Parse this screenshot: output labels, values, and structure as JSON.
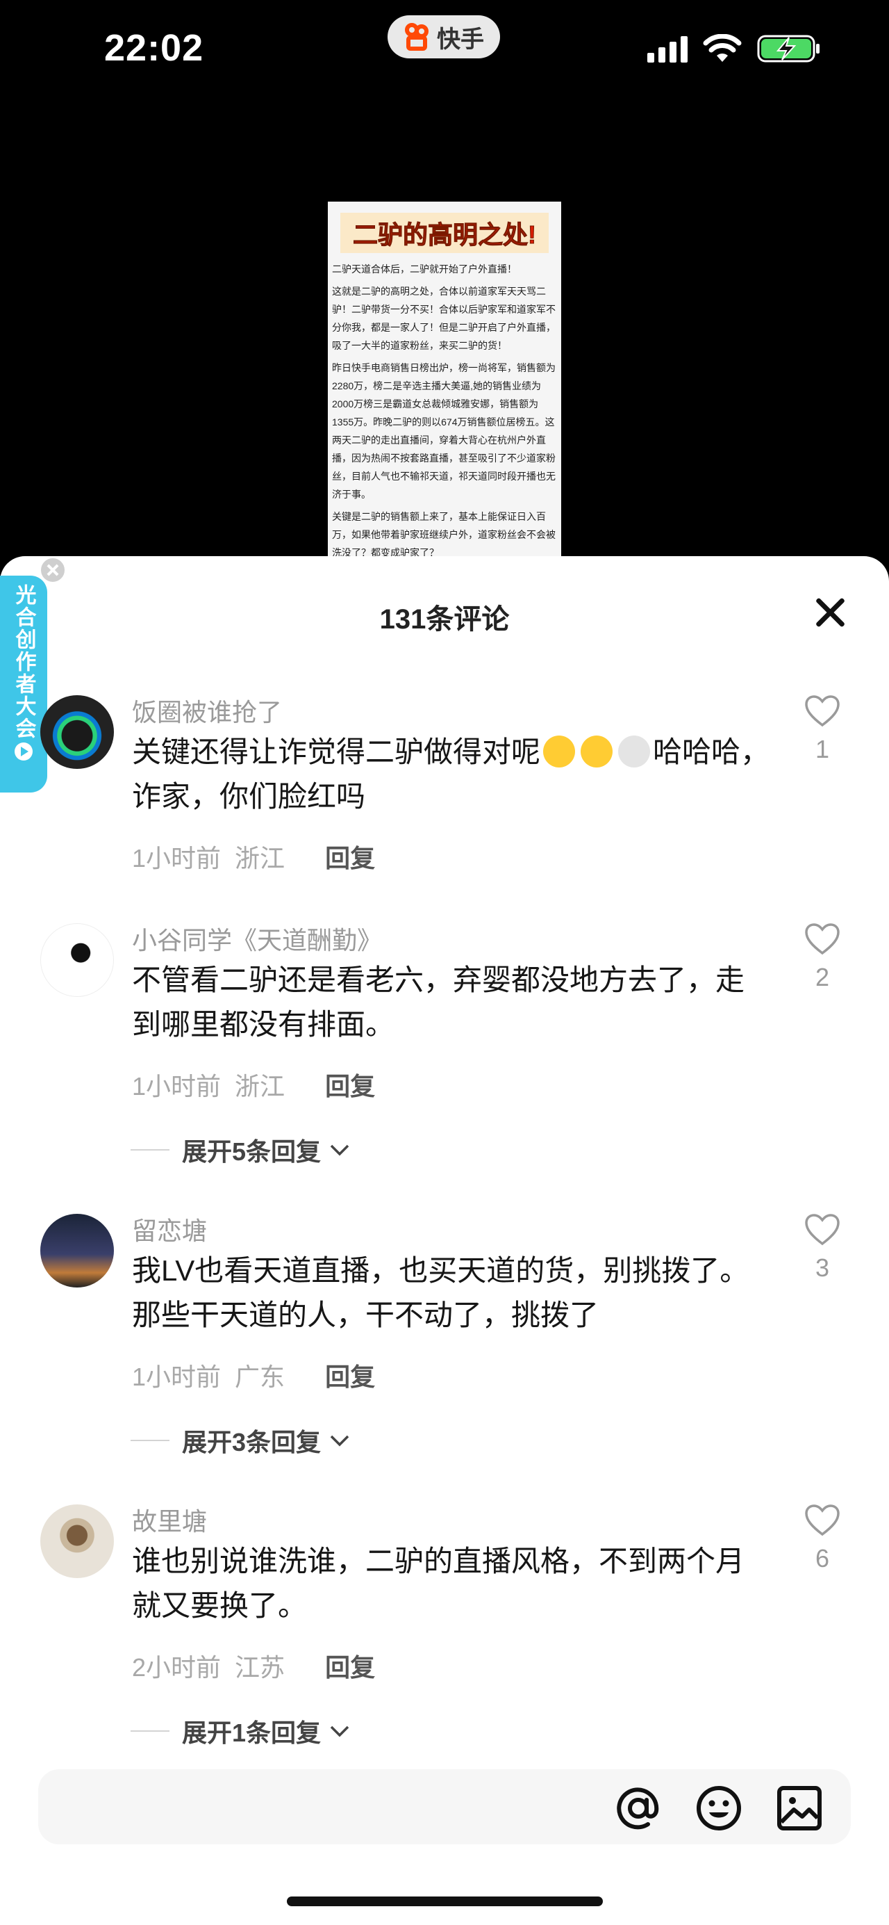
{
  "status_bar": {
    "time": "22:02",
    "app_name": "快手",
    "icons": [
      "signal-icon",
      "wifi-icon",
      "battery-charging-icon"
    ],
    "battery_color": "#4cd964"
  },
  "video": {
    "doc_title": "二驴的高明之处!",
    "paragraphs": [
      "二驴天道合体后，二驴就开始了户外直播！",
      "这就是二驴的高明之处，合体以前道家军天天骂二驴！二驴带货一分不买！合体以后驴家军和道家军不分你我，都是一家人了！但是二驴开启了户外直播，吸了一大半的道家粉丝，来买二驴的货！",
      "昨日快手电商销售日榜出炉，榜一尚将军，销售额为2280万，榜二是辛选主播大美逼,她的销售业绩为2000万榜三是霸道女总裁倾城雅安娜，销售额为1355万。昨晚二驴的则以674万销售额位居榜五。这两天二驴的走出直播间，穿着大背心在杭州户外直播，因为热闹不按套路直播，甚至吸引了不少道家粉丝，目前人气也不输祁天道，祁天道同时段开播也无济于事。",
      "关键是二驴的销售额上来了，基本上能保证日入百万，如果他带着驴家班继续户外，道家粉丝会不会被洗没了？都变成驴家了？"
    ]
  },
  "side_badge": {
    "label": "光合创作者大会"
  },
  "sheet": {
    "title": "131条评论"
  },
  "comments": [
    {
      "username": "饭圈被谁抢了",
      "text_a": "关键还得让诈觉得二驴做得对呢",
      "text_b": "哈哈哈，诈家，你们脸红吗",
      "time": "1小时前",
      "region": "浙江",
      "reply": "回复",
      "likes": "1"
    },
    {
      "username": "小谷同学《天道酬勤》",
      "text": "不管看二驴还是看老六，弃婴都没地方去了，走到哪里都没有排面。",
      "time": "1小时前",
      "region": "浙江",
      "reply": "回复",
      "likes": "2",
      "expand": "展开5条回复"
    },
    {
      "username": "留恋塘",
      "text": "我LV也看天道直播，也买天道的货，别挑拨了。那些干天道的人，干不动了，挑拨了",
      "time": "1小时前",
      "region": "广东",
      "reply": "回复",
      "likes": "3",
      "expand": "展开3条回复"
    },
    {
      "username": "故里塘",
      "text": "谁也别说谁洗谁，二驴的直播风格，不到两个月就又要换了。",
      "time": "2小时前",
      "region": "江苏",
      "reply": "回复",
      "likes": "6",
      "expand": "展开1条回复"
    }
  ],
  "input_bar": {
    "placeholder": "",
    "icons": [
      "at-icon",
      "emoji-icon",
      "image-icon"
    ]
  }
}
